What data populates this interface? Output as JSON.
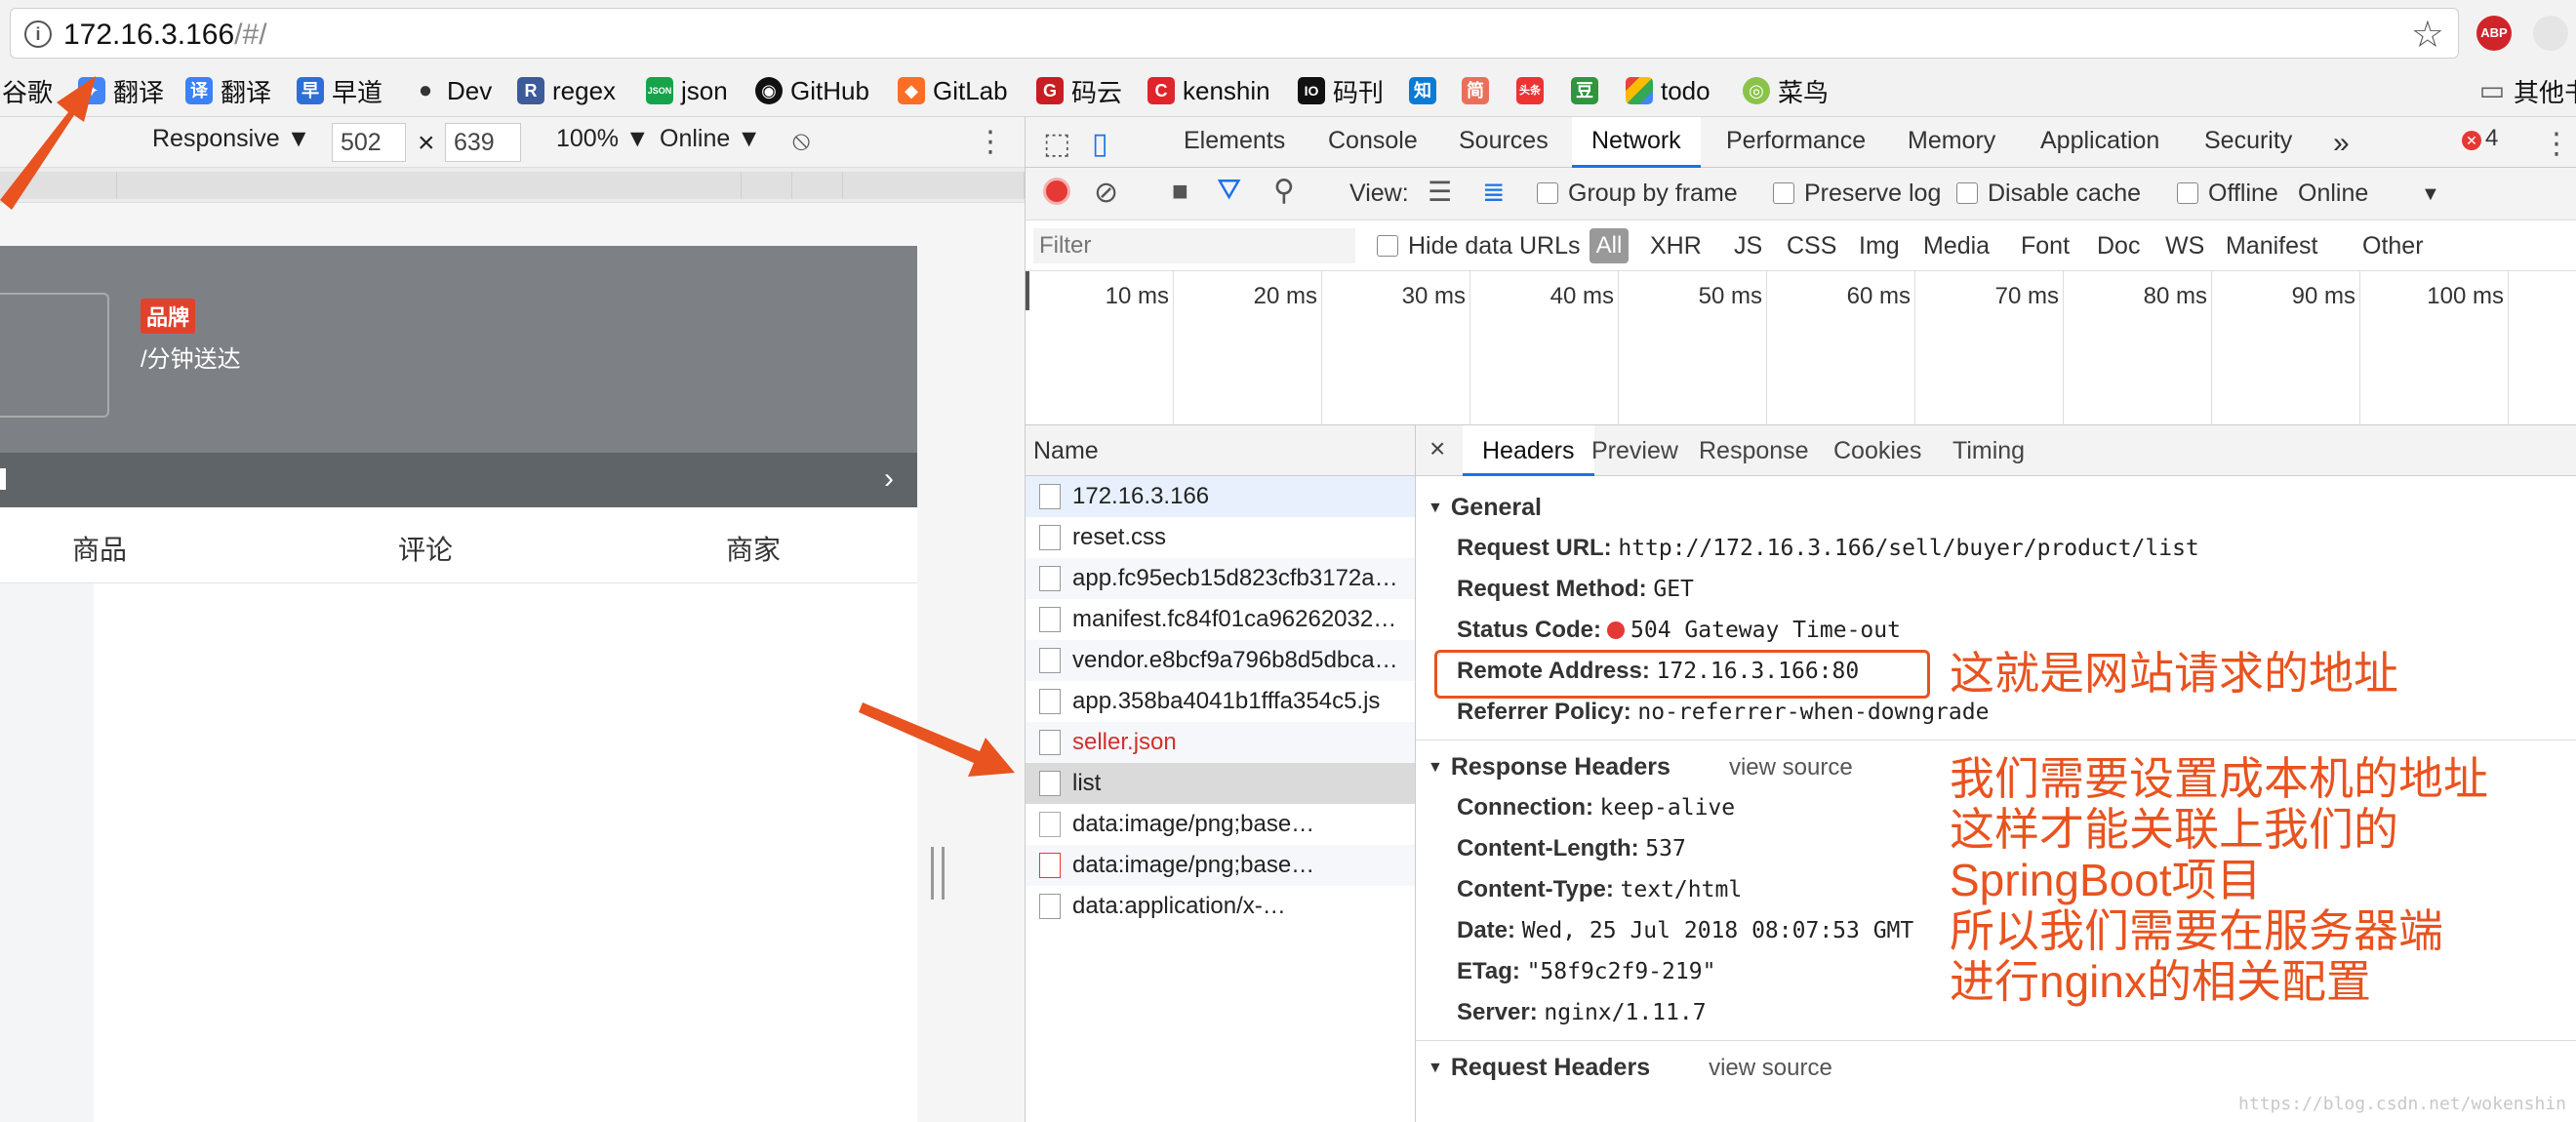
{
  "address_bar": {
    "url_host": "172.16.3.166",
    "url_path": "/#/"
  },
  "bookmarks": [
    {
      "label": "谷歌",
      "icon": "google-icon"
    },
    {
      "label": "翻译",
      "icon": "google-translate-icon"
    },
    {
      "label": "翻译",
      "icon": "translate-icon"
    },
    {
      "label": "早道",
      "icon": "zaodao-icon"
    },
    {
      "label": "Dev",
      "icon": "apple-icon"
    },
    {
      "label": "regex",
      "icon": "regex-icon"
    },
    {
      "label": "json",
      "icon": "json-icon"
    },
    {
      "label": "GitHub",
      "icon": "github-icon"
    },
    {
      "label": "GitLab",
      "icon": "gitlab-icon"
    },
    {
      "label": "码云",
      "icon": "gitee-icon"
    },
    {
      "label": "kenshin",
      "icon": "kenshin-icon"
    },
    {
      "label": "码刊",
      "icon": "io-icon"
    },
    {
      "label": "",
      "icon": "zhihu-icon"
    },
    {
      "label": "",
      "icon": "jian-icon"
    },
    {
      "label": "",
      "icon": "toutiao-icon"
    },
    {
      "label": "",
      "icon": "douban-icon"
    },
    {
      "label": "todo",
      "icon": "todo-icon"
    },
    {
      "label": "菜鸟",
      "icon": "runoob-icon"
    },
    {
      "label": "其他书",
      "icon": "folder-icon"
    }
  ],
  "bookmark_badges": {
    "zhihu": "知",
    "jian": "简",
    "toutiao": "头条",
    "douban": "豆",
    "io": "IO",
    "regex": "R",
    "json": "JSON",
    "zaodao": "早",
    "translate": "译",
    "kenshin": "C",
    "gitee": "G"
  },
  "device_toolbar": {
    "mode": "Responsive ▼",
    "width": "502",
    "times": "×",
    "height": "639",
    "zoom": "100% ▼",
    "network": "Online ▼"
  },
  "phone": {
    "brand_badge": "品牌",
    "delivery_text": "/分钟送达",
    "notice_chevron": "›",
    "tabs": [
      "商品",
      "评论",
      "商家"
    ]
  },
  "devtools": {
    "tabs": [
      "Elements",
      "Console",
      "Sources",
      "Network",
      "Performance",
      "Memory",
      "Application",
      "Security"
    ],
    "more": "»",
    "error_count": "4",
    "error_mark": "✕"
  },
  "network_toolbar": {
    "view_label": "View:",
    "group_by_frame": "Group by frame",
    "preserve_log": "Preserve log",
    "disable_cache": "Disable cache",
    "offline": "Offline",
    "throttle": "Online",
    "throttle_arrow": "▼"
  },
  "filter_bar": {
    "placeholder": "Filter",
    "hide_data_urls": "Hide data URLs",
    "types": [
      "All",
      "XHR",
      "JS",
      "CSS",
      "Img",
      "Media",
      "Font",
      "Doc",
      "WS",
      "Manifest",
      "Other"
    ]
  },
  "timeline": {
    "ticks": [
      "10 ms",
      "20 ms",
      "30 ms",
      "40 ms",
      "50 ms",
      "60 ms",
      "70 ms",
      "80 ms",
      "90 ms",
      "100 ms"
    ]
  },
  "request_list": {
    "header": "Name",
    "rows": [
      {
        "name": "172.16.3.166",
        "state": "first"
      },
      {
        "name": "reset.css",
        "state": "normal"
      },
      {
        "name": "app.fc95ecb15d823cfb3172a…",
        "state": "alt"
      },
      {
        "name": "manifest.fc84f01ca96262032…",
        "state": "normal"
      },
      {
        "name": "vendor.e8bcf9a796b8d5dbca…",
        "state": "alt"
      },
      {
        "name": "app.358ba4041b1fffa354c5.js",
        "state": "normal"
      },
      {
        "name": "seller.json",
        "state": "red"
      },
      {
        "name": "list",
        "state": "sel"
      },
      {
        "name": "data:image/png;base…",
        "state": "normal"
      },
      {
        "name": "data:image/png;base…",
        "state": "alt"
      },
      {
        "name": "data:application/x-…",
        "state": "normal"
      }
    ]
  },
  "detail": {
    "close": "×",
    "tabs": [
      "Headers",
      "Preview",
      "Response",
      "Cookies",
      "Timing"
    ],
    "general": {
      "title": "General",
      "request_url_k": "Request URL:",
      "request_url_v": "http://172.16.3.166/sell/buyer/product/list",
      "request_method_k": "Request Method:",
      "request_method_v": "GET",
      "status_code_k": "Status Code:",
      "status_code_v": "504 Gateway Time-out",
      "remote_address_k": "Remote Address:",
      "remote_address_v": "172.16.3.166:80",
      "referrer_policy_k": "Referrer Policy:",
      "referrer_policy_v": "no-referrer-when-downgrade"
    },
    "response_headers": {
      "title": "Response Headers",
      "view_source": "view source",
      "connection_k": "Connection:",
      "connection_v": "keep-alive",
      "content_length_k": "Content-Length:",
      "content_length_v": "537",
      "content_type_k": "Content-Type:",
      "content_type_v": "text/html",
      "date_k": "Date:",
      "date_v": "Wed, 25 Jul 2018 08:07:53 GMT",
      "etag_k": "ETag:",
      "etag_v": "\"58f9c2f9-219\"",
      "server_k": "Server:",
      "server_v": "nginx/1.11.7"
    },
    "request_headers": {
      "title": "Request Headers",
      "view_source": "view source"
    }
  },
  "annotations": {
    "remote_note": "这就是网站请求的地址",
    "line1": "我们需要设置成本机的地址",
    "line2": "这样才能关联上我们的",
    "line3": "SpringBoot项目",
    "line4": "所以我们需要在服务器端",
    "line5": "进行nginx的相关配置"
  },
  "colors": {
    "accent": "#1a73e8",
    "annotation": "#e8531f",
    "error": "#e53935",
    "phone_header": "#7d8185"
  },
  "watermark": "https://blog.csdn.net/wokenshin"
}
